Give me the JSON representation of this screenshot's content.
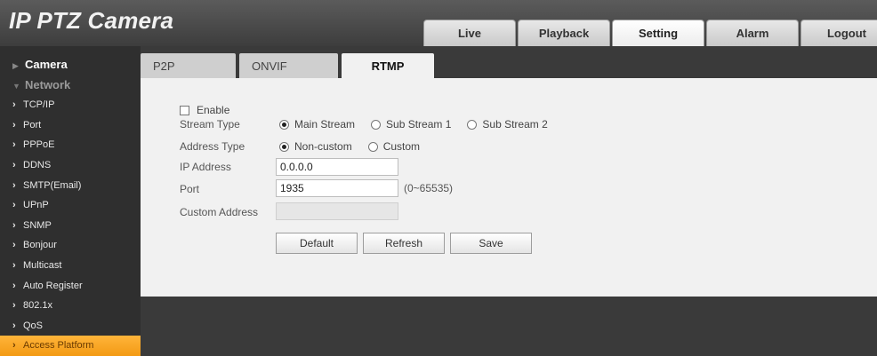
{
  "app": {
    "title": "IP PTZ Camera"
  },
  "topnav": {
    "tabs": [
      {
        "label": "Live"
      },
      {
        "label": "Playback"
      },
      {
        "label": "Setting",
        "active": true
      },
      {
        "label": "Alarm"
      },
      {
        "label": "Logout"
      }
    ]
  },
  "sidebar": {
    "sections": [
      {
        "label": "Camera"
      },
      {
        "label": "Network"
      }
    ],
    "items": [
      {
        "label": "TCP/IP"
      },
      {
        "label": "Port"
      },
      {
        "label": "PPPoE"
      },
      {
        "label": "DDNS"
      },
      {
        "label": "SMTP(Email)"
      },
      {
        "label": "UPnP"
      },
      {
        "label": "SNMP"
      },
      {
        "label": "Bonjour"
      },
      {
        "label": "Multicast"
      },
      {
        "label": "Auto Register"
      },
      {
        "label": "802.1x"
      },
      {
        "label": "QoS"
      },
      {
        "label": "Access Platform",
        "active": true
      }
    ]
  },
  "subtabs": [
    {
      "label": "P2P"
    },
    {
      "label": "ONVIF"
    },
    {
      "label": "RTMP",
      "active": true
    }
  ],
  "form": {
    "enable": {
      "label": "Enable",
      "checked": false
    },
    "stream_type": {
      "label": "Stream Type",
      "options": [
        "Main Stream",
        "Sub Stream 1",
        "Sub Stream 2"
      ],
      "selected": "Main Stream"
    },
    "address_type": {
      "label": "Address Type",
      "options": [
        "Non-custom",
        "Custom"
      ],
      "selected": "Non-custom"
    },
    "ip_address": {
      "label": "IP Address",
      "value": "0.0.0.0"
    },
    "port": {
      "label": "Port",
      "value": "1935",
      "hint": "(0~65535)"
    },
    "custom_address": {
      "label": "Custom Address",
      "value": ""
    }
  },
  "buttons": {
    "default": "Default",
    "refresh": "Refresh",
    "save": "Save"
  }
}
